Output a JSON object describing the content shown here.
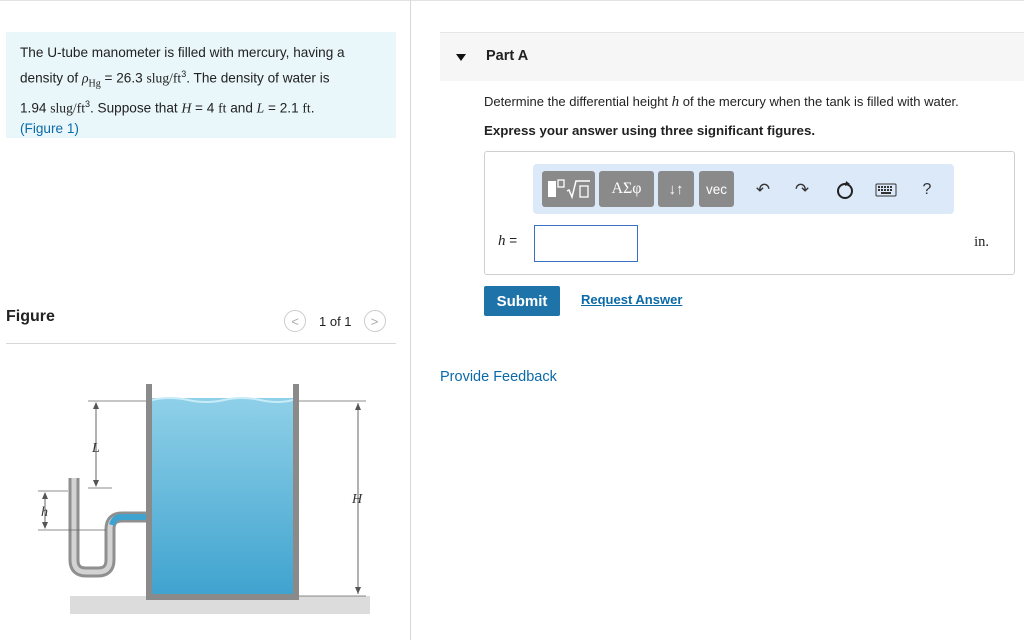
{
  "problem": {
    "text_1": "The U-tube manometer is filled with mercury, having a",
    "text_2a": "density of ",
    "rho_symbol": "ρ",
    "rho_sub": "Hg",
    "text_2b": " = 26.3 ",
    "unit_slug": "slug/ft",
    "exp3": "3",
    "text_2c": ". The density of water is",
    "text_3a": "1.94 ",
    "text_3b": ". Suppose that ",
    "H_sym": "H",
    "text_3c": " = 4  ",
    "ft": "ft",
    "text_3d": " and ",
    "L_sym": "L",
    "text_3e": " = 2.1  ",
    "text_3f": ".",
    "figure_link": "Figure 1",
    "paren_open": "(",
    "paren_close": ")"
  },
  "figure": {
    "heading": "Figure",
    "pager": "1 of 1",
    "prev_icon": "<",
    "next_icon": ">",
    "label_L": "L",
    "label_h": "h",
    "label_H": "H",
    "colors": {
      "water": "#52b2d8",
      "water_surface": "#a9dbee",
      "tube": "#8f8f8f"
    }
  },
  "part": {
    "label": "Part A",
    "question_a": "Determine the differential height ",
    "h_sym": "h",
    "question_b": " of the mercury when the tank is filled with water.",
    "instruction": "Express your answer using three significant figures."
  },
  "toolbar": {
    "greek": "ΑΣφ",
    "arrows": "↓↑",
    "vec": "vec",
    "help": "?"
  },
  "answer": {
    "var": "h",
    "eq": " =",
    "value": "",
    "unit": "in."
  },
  "actions": {
    "submit": "Submit",
    "request": "Request Answer",
    "feedback": "Provide Feedback"
  },
  "colors": {
    "accent": "#1e73a8",
    "link": "#0b6aa8",
    "problem_bg": "#e9f6fa",
    "toolbar_bg": "#dce9f8"
  }
}
